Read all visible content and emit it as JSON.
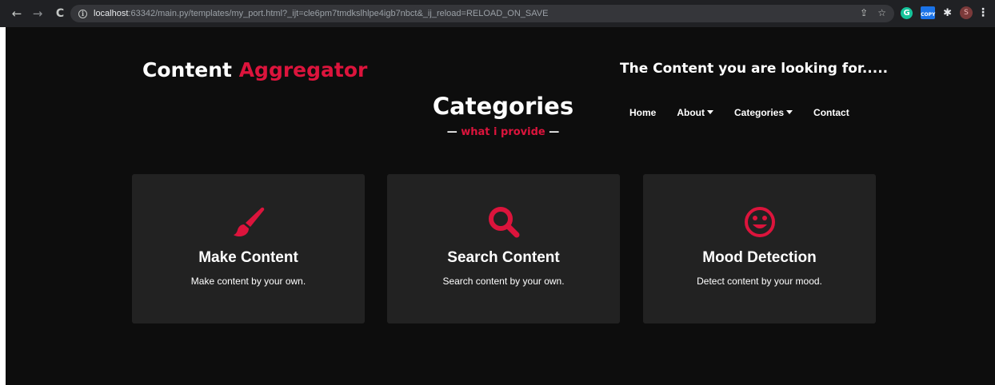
{
  "browser": {
    "url_host": "localhost",
    "url_rest": ":63342/main.py/templates/my_port.html?_ijt=cle6pm7tmdkslhlpe4igb7nbct&_ij_reload=RELOAD_ON_SAVE",
    "ext_grammarly": "G",
    "ext_copy": "COPY",
    "avatar": "S"
  },
  "header": {
    "logo_main": "Content",
    "logo_accent": "Aggregator",
    "tagline": "The Content you are looking for....."
  },
  "section": {
    "title": "Categories",
    "subtitle_dash_left": "—",
    "subtitle": "what i provide",
    "subtitle_dash_right": "—"
  },
  "nav": {
    "items": [
      "Home",
      "About",
      "Categories",
      "Contact"
    ]
  },
  "cards": [
    {
      "icon": "paintbrush-icon",
      "title": "Make Content",
      "desc": "Make content by your own."
    },
    {
      "icon": "search-icon",
      "title": "Search Content",
      "desc": "Search content by your own."
    },
    {
      "icon": "smile-icon",
      "title": "Mood Detection",
      "desc": "Detect content by your mood."
    }
  ],
  "colors": {
    "accent": "#dc143c",
    "page_bg": "#0d0d0d",
    "card_bg": "#222222"
  }
}
